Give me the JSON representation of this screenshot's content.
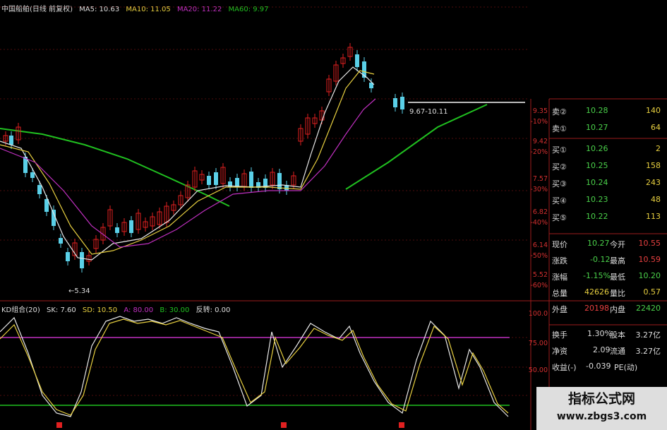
{
  "main_header": {
    "stock": "中国船舶(日线 前复权)",
    "ma5": "MA5: 10.63",
    "ma10": "MA10: 11.05",
    "ma20": "MA20: 11.22",
    "ma60": "MA60: 9.97"
  },
  "colors": {
    "background": "#000000",
    "grid_red": "#9b1b1b",
    "up_candle": "#e02020",
    "down_candle": "#5ad0e8",
    "ma5": "#e8e8e8",
    "ma10": "#e8d040",
    "ma20": "#c030c0",
    "ma60": "#20c020",
    "kdj_sk": "#e8e8e8",
    "kdj_sd": "#e8d040",
    "line_a": "#c030c0",
    "line_b": "#20c020"
  },
  "price_axis": [
    "9.35",
    "-10%",
    "9.42",
    "-20%",
    "7.57",
    "-30%",
    "6.82",
    "-40%",
    "6.14",
    "-50%",
    "5.52",
    "-60%"
  ],
  "annotations": {
    "low": "←5.34",
    "high": "9.67-10.11"
  },
  "kd_header": {
    "name": "KD组合(20)",
    "sk": "SK: 7.60",
    "sd": "SD: 10.50",
    "a": "A: 80.00",
    "b": "B: 30.00",
    "fz": "反转: 0.00"
  },
  "kd_axis": [
    "100.0",
    "75.00",
    "50.00"
  ],
  "order_book": [
    {
      "name": "卖②",
      "price": "10.28",
      "vol": "140"
    },
    {
      "name": "卖①",
      "price": "10.27",
      "vol": "64"
    },
    {
      "name": "买①",
      "price": "10.26",
      "vol": "2"
    },
    {
      "name": "买②",
      "price": "10.25",
      "vol": "158"
    },
    {
      "name": "买③",
      "price": "10.24",
      "vol": "243"
    },
    {
      "name": "买④",
      "price": "10.23",
      "vol": "48"
    },
    {
      "name": "买⑤",
      "price": "10.22",
      "vol": "113"
    }
  ],
  "quote": {
    "xianjia_l": "现价",
    "xianjia": "10.27",
    "jinkai_l": "今开",
    "jinkai": "10.55",
    "zhangdie_l": "涨跌",
    "zhangdie": "-0.12",
    "zuigao_l": "最高",
    "zuigao": "10.59",
    "zhangfu_l": "涨幅",
    "zhangfu": "-1.15%",
    "zuidi_l": "最低",
    "zuidi": "10.20",
    "zongliang_l": "总量",
    "zongliang": "42626",
    "liangbi_l": "量比",
    "liangbi": "0.57",
    "waipan_l": "外盘",
    "waipan": "20198",
    "neipan_l": "内盘",
    "neipan": "22420",
    "huanshou_l": "换手",
    "huanshou": "1.30%",
    "guben_l": "股本",
    "guben": "3.27亿",
    "jingzi_l": "净资",
    "jingzi": "2.09",
    "liutong_l": "流通",
    "liutong": "3.27亿",
    "shouyi_l": "收益(-)",
    "shouyi": "-0.039",
    "pe_l": "PE(动)"
  },
  "watermark": {
    "title": "指标公式网",
    "url": "www.zbgs3.com"
  }
}
